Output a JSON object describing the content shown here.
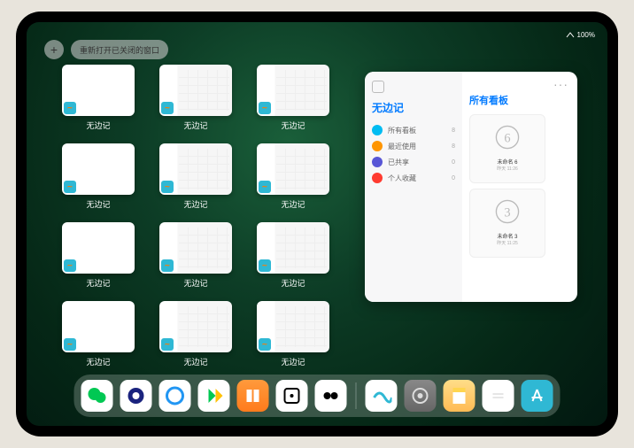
{
  "status": {
    "battery": "100%",
    "wifi": "•"
  },
  "topbar": {
    "plus": "+",
    "reopen_label": "重新打开已关闭的窗口"
  },
  "thumbnails": [
    {
      "label": "无边记",
      "type": "blank"
    },
    {
      "label": "无边记",
      "type": "table"
    },
    {
      "label": "无边记",
      "type": "table"
    },
    {
      "label": "无边记",
      "type": "blank"
    },
    {
      "label": "无边记",
      "type": "table"
    },
    {
      "label": "无边记",
      "type": "table"
    },
    {
      "label": "无边记",
      "type": "blank"
    },
    {
      "label": "无边记",
      "type": "table"
    },
    {
      "label": "无边记",
      "type": "table"
    },
    {
      "label": "无边记",
      "type": "blank"
    },
    {
      "label": "无边记",
      "type": "table"
    },
    {
      "label": "无边记",
      "type": "table"
    }
  ],
  "sidebar": {
    "app_title": "无边记",
    "items": [
      {
        "icon": "ic-blue",
        "label": "所有看板",
        "count": "8"
      },
      {
        "icon": "ic-orange",
        "label": "最近使用",
        "count": "8"
      },
      {
        "icon": "ic-purple",
        "label": "已共享",
        "count": "0"
      },
      {
        "icon": "ic-red",
        "label": "个人收藏",
        "count": "0"
      }
    ],
    "right_title": "所有看板",
    "boards": [
      {
        "name": "未命名 6",
        "sub": "昨天 11:26",
        "digit": "6"
      },
      {
        "name": "未命名 3",
        "sub": "昨天 11:25",
        "digit": "3"
      }
    ],
    "more": "···"
  },
  "dock": {
    "apps": [
      {
        "name": "wechat-icon"
      },
      {
        "name": "qq-icon"
      },
      {
        "name": "browser-icon"
      },
      {
        "name": "play-icon"
      },
      {
        "name": "books-icon"
      },
      {
        "name": "dice-icon"
      },
      {
        "name": "round-icon"
      }
    ],
    "recent": [
      {
        "name": "freeform-icon"
      },
      {
        "name": "settings-icon"
      },
      {
        "name": "pages-icon"
      },
      {
        "name": "notes-icon"
      },
      {
        "name": "appstore-icon"
      }
    ]
  },
  "colors": {
    "accent": "#007aff"
  }
}
